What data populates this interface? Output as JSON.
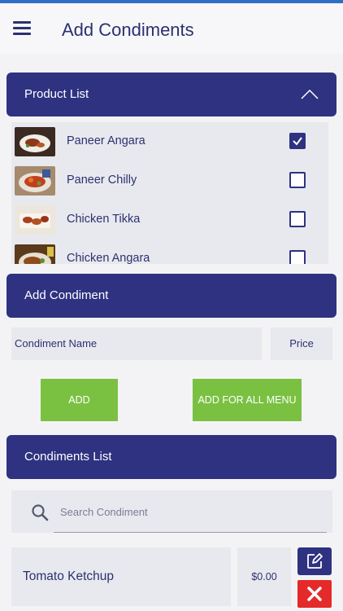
{
  "header": {
    "title": "Add Condiments",
    "menu_icon": "hamburger-menu-icon"
  },
  "product_list": {
    "label": "Product List",
    "toggle_icon": "chevron-up-icon",
    "items": [
      {
        "name": "Paneer Angara",
        "checked": true
      },
      {
        "name": "Paneer Chilly",
        "checked": false
      },
      {
        "name": "Chicken Tikka",
        "checked": false
      },
      {
        "name": "Chicken Angara",
        "checked": false
      }
    ]
  },
  "add_condiment": {
    "label": "Add Condiment",
    "name_placeholder": "Condiment Name",
    "price_placeholder": "Price",
    "add_label": "ADD",
    "add_all_label": "ADD FOR ALL MENU"
  },
  "condiments_list": {
    "label": "Condiments List",
    "search_placeholder": "Search Condiment",
    "items": [
      {
        "name": "Tomato Ketchup",
        "price": "$0.00"
      }
    ]
  },
  "colors": {
    "primary": "#2e3280",
    "accent_green": "#7ac142",
    "danger": "#e52a2a"
  }
}
